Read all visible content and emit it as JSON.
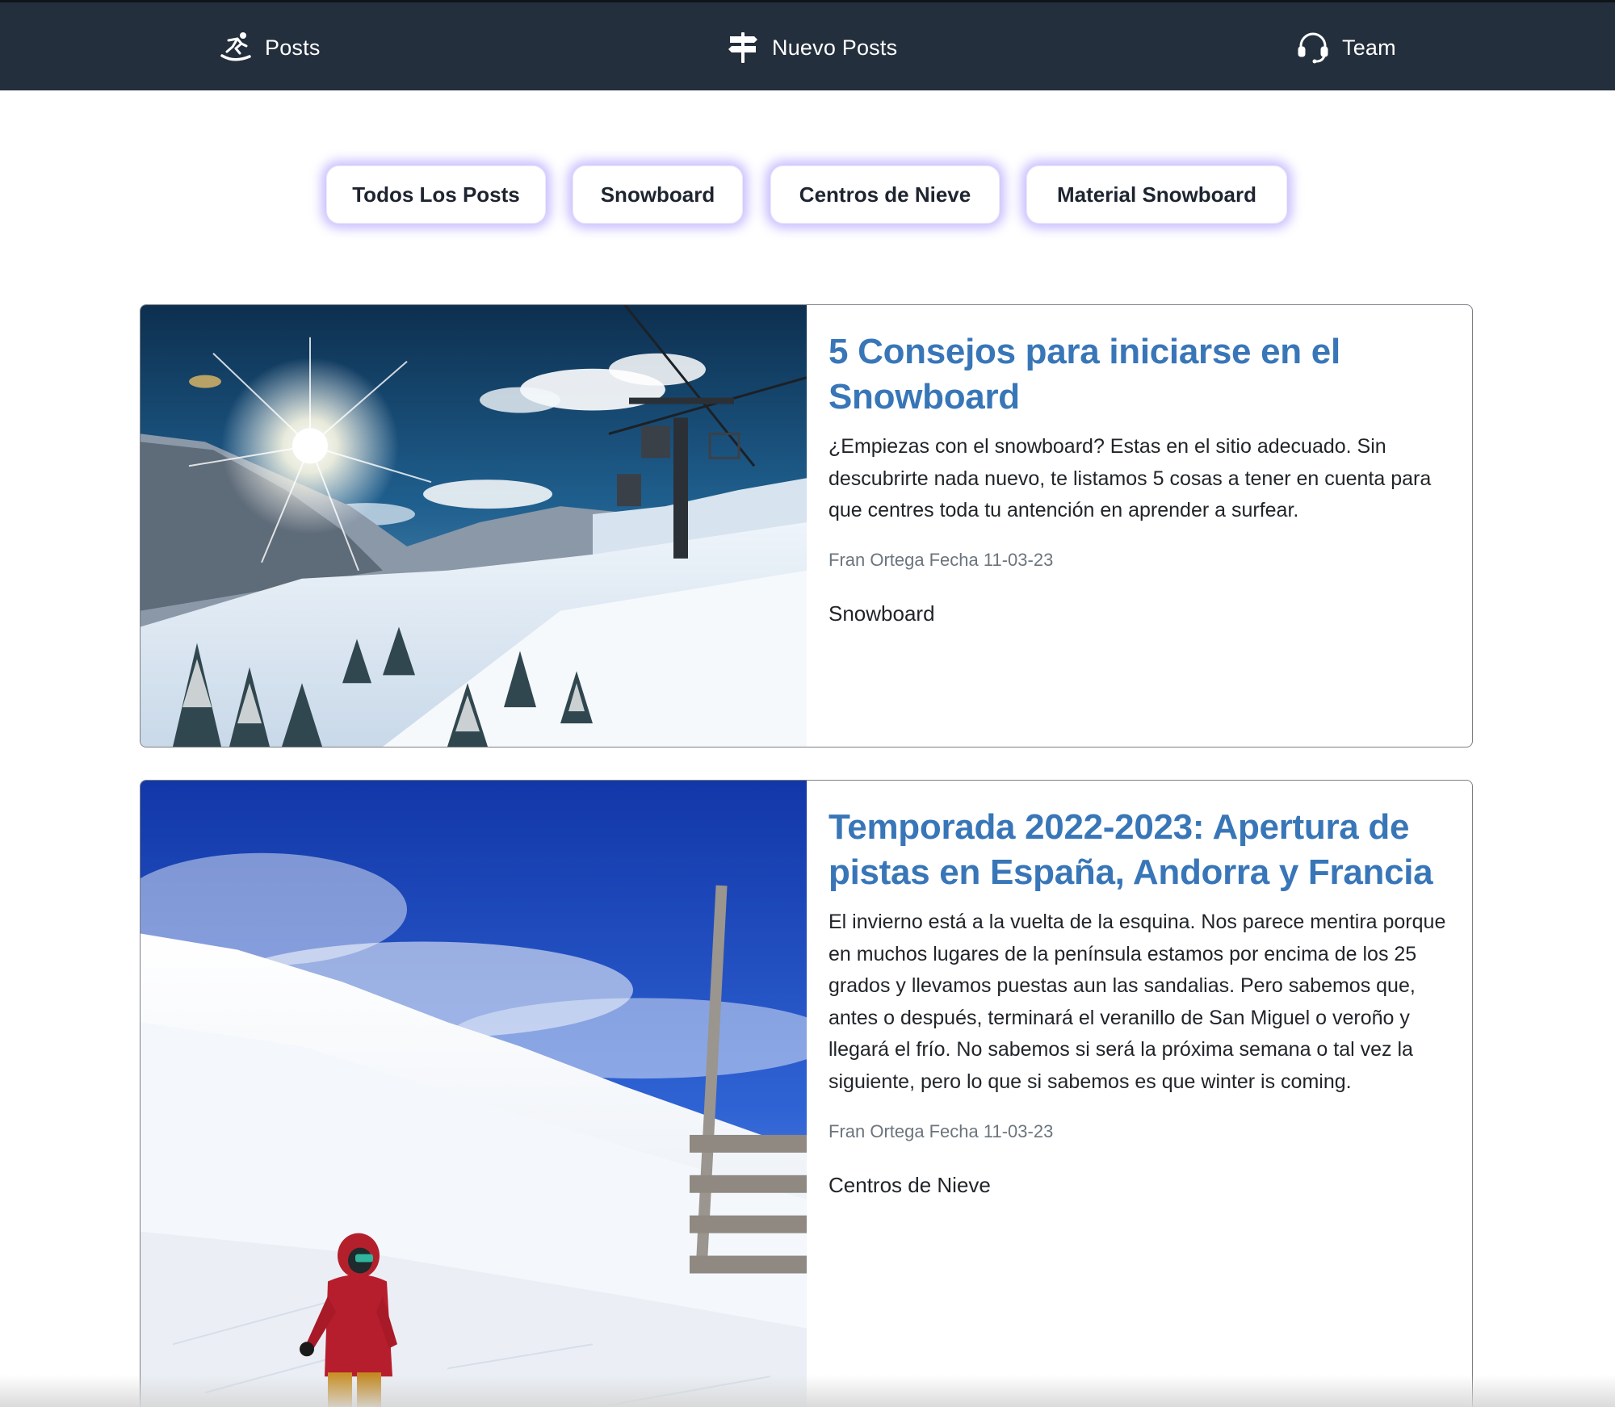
{
  "nav": {
    "items": [
      {
        "label": "Posts",
        "icon": "snowboarder-icon"
      },
      {
        "label": "Nuevo Posts",
        "icon": "signpost-icon"
      },
      {
        "label": "Team",
        "icon": "headset-icon"
      }
    ]
  },
  "filters": [
    {
      "label": "Todos Los Posts"
    },
    {
      "label": "Snowboard"
    },
    {
      "label": "Centros de Nieve"
    },
    {
      "label": "Material Snowboard"
    }
  ],
  "posts": [
    {
      "title": "5 Consejos para iniciarse en el Snowboard",
      "excerpt": "¿Empiezas con el snowboard? Estas en el sitio adecuado. Sin descubrirte nada nuevo, te listamos 5 cosas a tener en cuenta para que centres toda tu antención en aprender a surfear.",
      "author": "Fran Ortega",
      "date": "Fecha 11-03-23",
      "category": "Snowboard"
    },
    {
      "title": "Temporada 2022-2023: Apertura de pistas en España, Andorra y Francia",
      "excerpt": "El invierno está a la vuelta de la esquina. Nos parece mentira porque en muchos lugares de la península estamos por encima de los 25 grados y llevamos puestas aun las sandalias. Pero sabemos que, antes o después, terminará el veranillo de San Miguel o veroño y llegará el frío. No sabemos si será la próxima semana o tal vez la siguiente, pero lo que si sabemos es que winter is coming.",
      "author": "Fran Ortega",
      "date": "Fecha 11-03-23",
      "category": "Centros de Nieve"
    }
  ],
  "colors": {
    "nav_bg": "#242f3d",
    "title": "#3876b8",
    "button_glow": "#7c60ff",
    "meta": "#6c757d"
  }
}
